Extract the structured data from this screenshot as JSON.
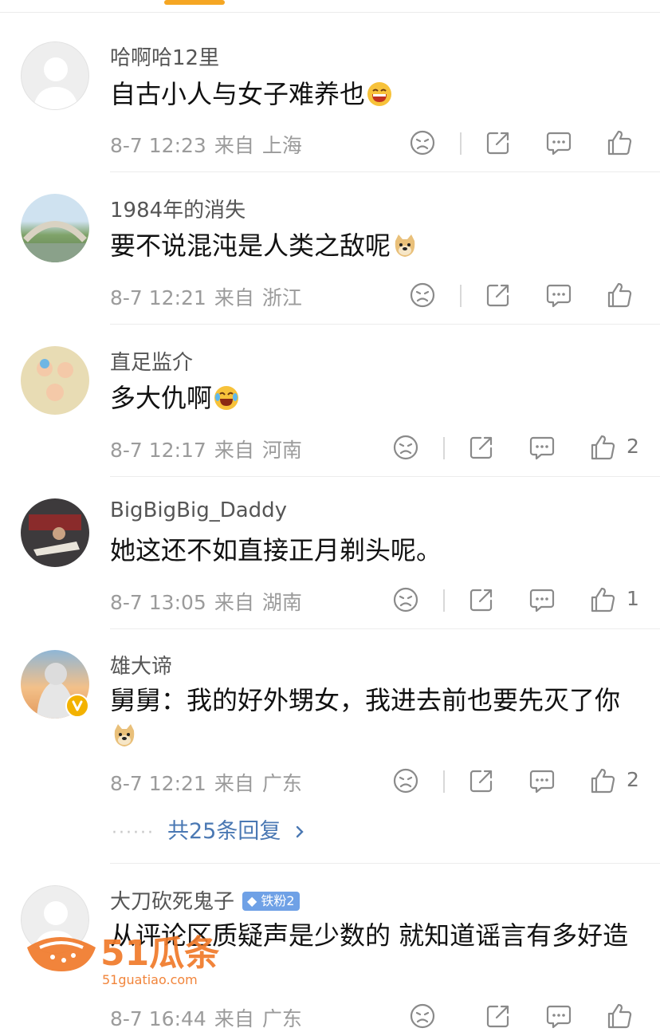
{
  "colors": {
    "accent": "#f5a623",
    "link": "#4a78b3",
    "meta": "#9b9b9b",
    "icon": "#8a8a8a"
  },
  "comments": [
    {
      "username": "哈啊哈12里",
      "text": "自古小人与女子难养也",
      "emoji": "grin-emoji",
      "date": "8-7 12:23",
      "from": "来自",
      "location": "上海",
      "likes": ""
    },
    {
      "username": "1984年的消失",
      "text": "要不说混沌是人类之敌呢",
      "emoji": "doge-emoji",
      "date": "8-7 12:21",
      "from": "来自",
      "location": "浙江",
      "likes": ""
    },
    {
      "username": "直足监介",
      "text": "多大仇啊",
      "emoji": "laugh-cry-emoji",
      "date": "8-7 12:17",
      "from": "来自",
      "location": "河南",
      "likes": "2"
    },
    {
      "username": "BigBigBig_Daddy",
      "text": "她这还不如直接正月剃头呢。",
      "emoji": "",
      "date": "8-7 13:05",
      "from": "来自",
      "location": "湖南",
      "likes": "1"
    },
    {
      "username": "雄大谛",
      "text": "舅舅：我的好外甥女，我进去前也要先灭了你",
      "emoji": "doge-emoji",
      "date": "8-7 12:21",
      "from": "来自",
      "location": "广东",
      "likes": "2",
      "replies": "共25条回复"
    },
    {
      "username": "大刀砍死鬼子",
      "badge": "铁粉2",
      "text": "从评论区质疑声是少数的 就知道谣言有多好造",
      "emoji": "",
      "date": "8-7 16:44",
      "from": "来自",
      "location": "广东",
      "likes": ""
    }
  ],
  "watermark": {
    "brand": "51瓜条",
    "url": "51guatiao.com"
  },
  "icons": [
    "dislike-icon",
    "share-icon",
    "comment-icon",
    "like-icon",
    "verified-v-icon",
    "chevron-right-icon"
  ]
}
